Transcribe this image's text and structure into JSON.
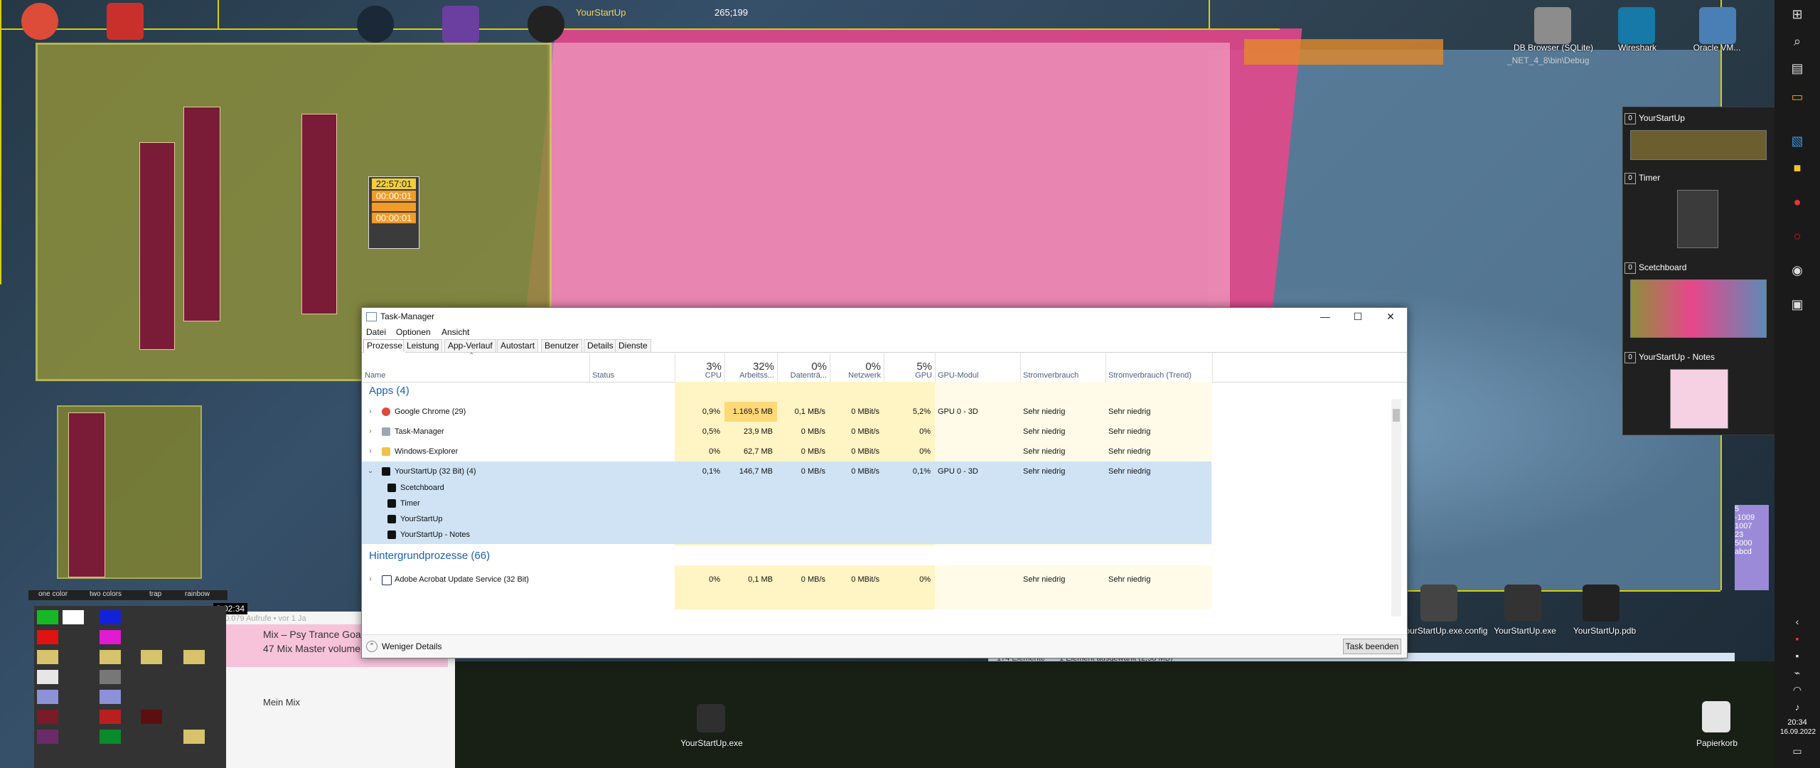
{
  "taskmanager": {
    "title": "Task-Manager",
    "menu": [
      "Datei",
      "Optionen",
      "Ansicht"
    ],
    "tabs": [
      "Prozesse",
      "Leistung",
      "App-Verlauf",
      "Autostart",
      "Benutzer",
      "Details",
      "Dienste"
    ],
    "columns": {
      "name": "Name",
      "status": "Status",
      "cpu": {
        "pct": "3%",
        "label": "CPU"
      },
      "mem": {
        "pct": "32%",
        "label": "Arbeitss..."
      },
      "disk": {
        "pct": "0%",
        "label": "Datenträ..."
      },
      "net": {
        "pct": "0%",
        "label": "Netzwerk"
      },
      "gpu": {
        "pct": "5%",
        "label": "GPU"
      },
      "gpumod": "GPU-Modul",
      "power": "Stromverbrauch",
      "powertrend": "Stromverbrauch (Trend)"
    },
    "groups": {
      "apps": "Apps (4)",
      "background": "Hintergrundprozesse (66)"
    },
    "rows": [
      {
        "name": "Google Chrome (29)",
        "cpu": "0,9%",
        "mem": "1.169,5 MB",
        "disk": "0,1 MB/s",
        "net": "0 MBit/s",
        "gpu": "5,2%",
        "gpumod": "GPU 0 - 3D",
        "power": "Sehr niedrig",
        "trend": "Sehr niedrig"
      },
      {
        "name": "Task-Manager",
        "cpu": "0,5%",
        "mem": "23,9 MB",
        "disk": "0 MB/s",
        "net": "0 MBit/s",
        "gpu": "0%",
        "gpumod": "",
        "power": "Sehr niedrig",
        "trend": "Sehr niedrig"
      },
      {
        "name": "Windows-Explorer",
        "cpu": "0%",
        "mem": "62,7 MB",
        "disk": "0 MB/s",
        "net": "0 MBit/s",
        "gpu": "0%",
        "gpumod": "",
        "power": "Sehr niedrig",
        "trend": "Sehr niedrig"
      },
      {
        "name": "YourStartUp (32 Bit) (4)",
        "cpu": "0,1%",
        "mem": "146,7 MB",
        "disk": "0 MB/s",
        "net": "0 MBit/s",
        "gpu": "0,1%",
        "gpumod": "GPU 0 - 3D",
        "power": "Sehr niedrig",
        "trend": "Sehr niedrig"
      }
    ],
    "children": [
      "Scetchboard",
      "Timer",
      "YourStartUp",
      "YourStartUp - Notes"
    ],
    "bg_rows": [
      {
        "name": "Adobe Acrobat Update Service (32 Bit)",
        "cpu": "0%",
        "mem": "0,1 MB",
        "disk": "0 MB/s",
        "net": "0 MBit/s",
        "gpu": "0%",
        "gpumod": "",
        "power": "Sehr niedrig",
        "trend": "Sehr niedrig"
      }
    ],
    "footer": {
      "fewer": "Weniger Details",
      "end_task": "Task beenden"
    },
    "window_buttons": {
      "min": "—",
      "max": "☐",
      "close": "✕"
    }
  },
  "thumbnails": {
    "items": [
      {
        "badge": "0",
        "title": "YourStartUp"
      },
      {
        "badge": "0",
        "title": "Timer"
      },
      {
        "badge": "0",
        "title": "Scetchboard"
      },
      {
        "badge": "0",
        "title": "YourStartUp - Notes"
      }
    ]
  },
  "desktop": {
    "top_labels": {
      "app": "YourStartUp",
      "coords": "265;199"
    },
    "right_labels": [
      "DB Browser (SQLite)",
      "Wireshark",
      "Oracle VM..."
    ],
    "timer": {
      "t1": "22:57:01",
      "t2": "00:00:01",
      "t3": "00:00:01"
    },
    "files": [
      "YourStartUp.exe.config",
      "YourStartUp.exe",
      "YourStartUp.pdb"
    ],
    "explorer_status": {
      "count": "174 Elemente",
      "selected": "1 Element ausgewählt (2,58 MB)"
    },
    "desktop_icon": "YourStartUp.exe",
    "recycle": "Papierkorb",
    "video": {
      "title": "Mix – Psy Trance Goa",
      "subtitle": "47 Mix Master volume",
      "views": "10.079 Aufrufe • vor 1 Ja",
      "duration": "2:02:34",
      "mix": "Mein Mix"
    },
    "color_options": [
      "one color",
      "two colors",
      "trap",
      "rainbow"
    ],
    "numbers": [
      "5",
      "-1009",
      "1007",
      "23",
      "5000",
      "abcd"
    ],
    "debug_path": "_NET_4_8\\bin\\Debug"
  },
  "taskbar": {
    "time": "20:34",
    "date": "16.09.2022"
  },
  "colors": {
    "accent": "#1a5fb4",
    "pink": "#e8478b",
    "heat": "#fff4c4",
    "selected": "#cfe3f5"
  }
}
